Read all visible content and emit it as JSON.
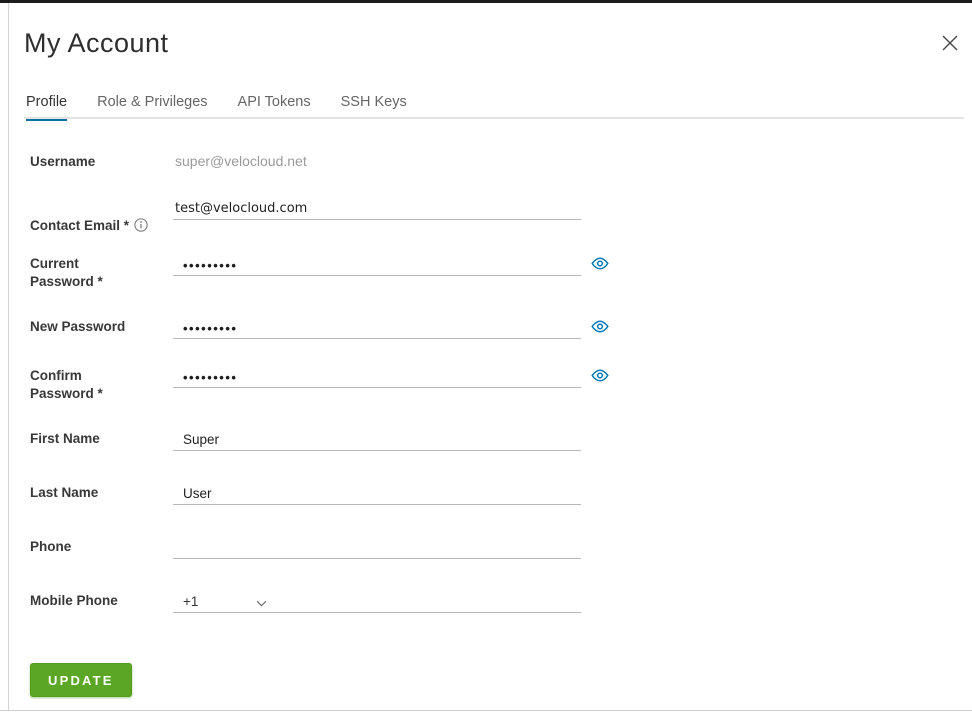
{
  "modal": {
    "title": "My Account"
  },
  "tabs": [
    {
      "label": "Profile",
      "active": true
    },
    {
      "label": "Role & Privileges",
      "active": false
    },
    {
      "label": "API Tokens",
      "active": false
    },
    {
      "label": "SSH Keys",
      "active": false
    }
  ],
  "form": {
    "username": {
      "label": "Username",
      "value": "super@velocloud.net"
    },
    "contact_email": {
      "label": "Contact Email *",
      "value": "test@velocloud.com"
    },
    "current_password": {
      "label": "Current\nPassword *",
      "value": "•••••••••"
    },
    "new_password": {
      "label": "New Password",
      "value": "•••••••••"
    },
    "confirm_password": {
      "label": "Confirm\nPassword *",
      "value": "•••••••••"
    },
    "first_name": {
      "label": "First Name",
      "value": "Super"
    },
    "last_name": {
      "label": "Last Name",
      "value": "User"
    },
    "phone": {
      "label": "Phone",
      "value": ""
    },
    "mobile_phone": {
      "label": "Mobile Phone",
      "country_code": "+1"
    }
  },
  "buttons": {
    "update": "UPDATE"
  },
  "icons": {
    "close": "x-cross",
    "info": "circled-i",
    "eye": "password-visibility-eye",
    "chevron_down": "dropdown-chevron"
  },
  "colors": {
    "tab_active_underline": "#0072a3",
    "eye_icon_blue": "#0079b8",
    "update_button_green": "#5ca626",
    "input_underline_gray": "#b7b7b7"
  }
}
